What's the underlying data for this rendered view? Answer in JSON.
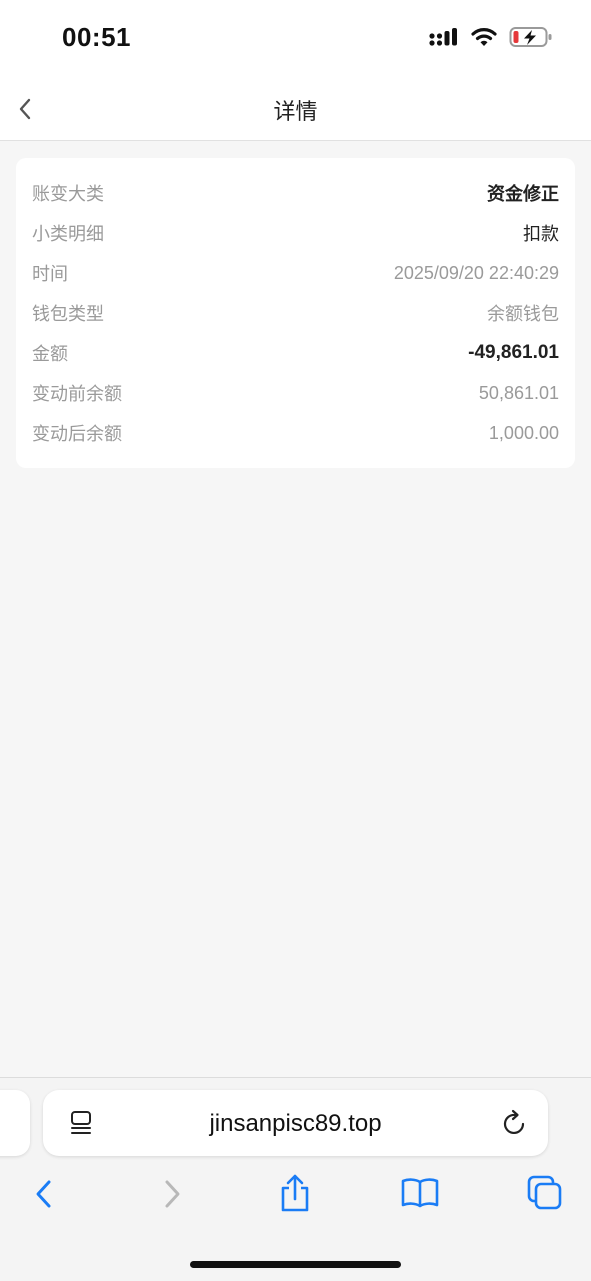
{
  "status_bar": {
    "time": "00:51"
  },
  "nav": {
    "title": "详情"
  },
  "details": [
    {
      "label": "账变大类",
      "value": "资金修正"
    },
    {
      "label": "小类明细",
      "value": "扣款"
    },
    {
      "label": "时间",
      "value": "2025/09/20 22:40:29"
    },
    {
      "label": "钱包类型",
      "value": "余额钱包"
    },
    {
      "label": "金额",
      "value": "-49,861.01"
    },
    {
      "label": "变动前余额",
      "value": "50,861.01"
    },
    {
      "label": "变动后余额",
      "value": "1,000.00"
    }
  ],
  "browser": {
    "url": "jinsanpisc89.top"
  },
  "icons": {
    "signal": "cellular-signal-icon",
    "wifi": "wifi-icon",
    "battery": "battery-charging-icon",
    "back": "chevron-left-icon",
    "reader": "reader-mode-icon",
    "reload": "reload-icon",
    "toolbar": [
      "back-arrow-icon",
      "forward-arrow-icon",
      "share-icon",
      "bookmarks-icon",
      "tabs-icon"
    ]
  },
  "colors": {
    "accent": "#1a7cf5",
    "battery_low": "#e5383b"
  }
}
